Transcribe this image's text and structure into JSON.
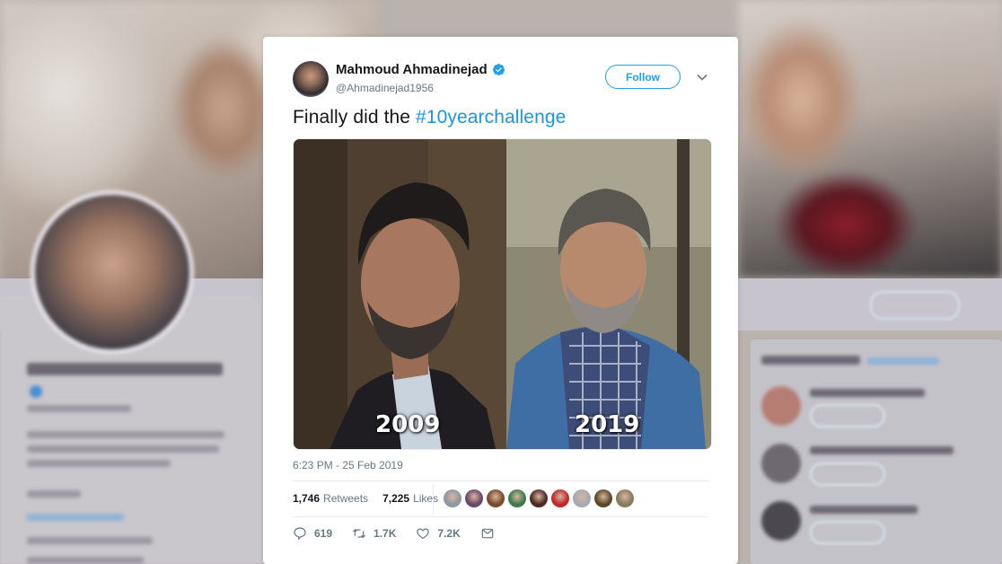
{
  "tweet": {
    "author_name": "Mahmoud Ahmadinejad",
    "handle": "@Ahmadinejad1956",
    "follow_label": "Follow",
    "text_prefix": "Finally did the ",
    "hashtag": "#10yearchallenge",
    "image_labels": [
      "2009",
      "2019"
    ],
    "timestamp": "6:23 PM - 25 Feb 2019",
    "retweets_count": "1,746",
    "retweets_label": "Retweets",
    "likes_count": "7,225",
    "likes_label": "Likes",
    "liker_avatar_colors": [
      "#8e97a3",
      "#6a4a6b",
      "#7a4b2d",
      "#3f7a4e",
      "#4b2a22",
      "#c02a2a",
      "#a4aab3",
      "#5b4a2a",
      "#8a7a60"
    ],
    "actions": {
      "reply_count": "619",
      "retweet_count": "1.7K",
      "like_count": "7.2K"
    }
  },
  "colors": {
    "accent": "#1da1f2",
    "hashtag": "#1b95e0",
    "secondary_text": "#657786"
  },
  "icons": [
    "verified-badge-icon",
    "chevron-down-icon",
    "reply-icon",
    "retweet-icon",
    "like-icon",
    "message-icon"
  ]
}
